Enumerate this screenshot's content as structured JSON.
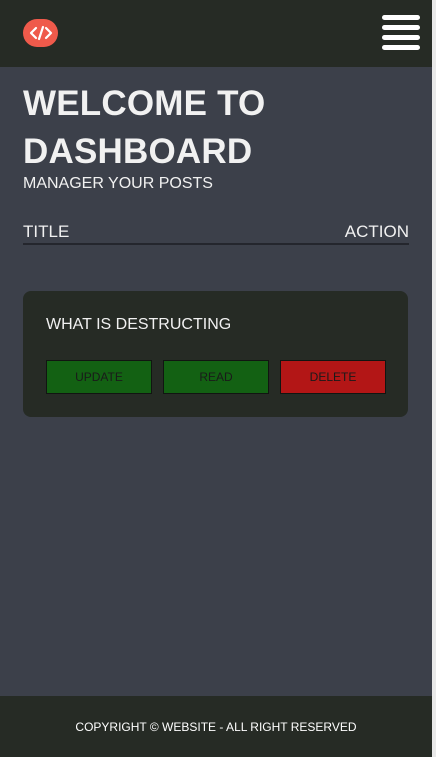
{
  "header": {
    "logo_icon": "code-brackets-icon",
    "logo_color": "#ef5a4b",
    "menu_icon": "hamburger-menu-icon"
  },
  "main": {
    "title": "WELCOME TO DASHBOARD",
    "subtitle": "MANAGER YOUR POSTS",
    "table": {
      "columns": [
        "TITLE",
        "ACTION"
      ]
    },
    "posts": [
      {
        "title": "WHAT IS DESTRUCTING",
        "actions": {
          "update": "UPDATE",
          "read": "READ",
          "delete": "DELETE"
        }
      }
    ]
  },
  "footer": {
    "copyright": "COPYRIGHT © WEBSITE - ALL RIGHT RESERVED"
  },
  "colors": {
    "navbar": "#262b25",
    "background": "#3c404a",
    "update_button": "#136113",
    "read_button": "#136113",
    "delete_button": "#b31616"
  }
}
